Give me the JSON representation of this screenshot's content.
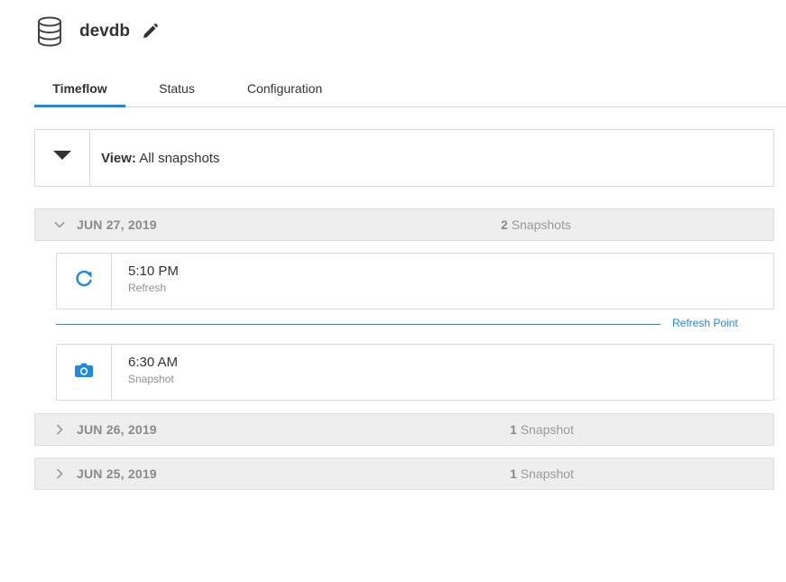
{
  "header": {
    "title": "devdb",
    "icon": "database-icon",
    "edit_icon": "pencil-icon"
  },
  "tabs": [
    {
      "label": "Timeflow",
      "active": true
    },
    {
      "label": "Status",
      "active": false
    },
    {
      "label": "Configuration",
      "active": false
    }
  ],
  "view": {
    "prefix": "View:",
    "value": "All snapshots",
    "toggle_icon": "caret-down-icon"
  },
  "groups": [
    {
      "date": "JUN 27, 2019",
      "count": "2",
      "count_label": "Snapshots",
      "expanded": true,
      "items": [
        {
          "time": "5:10 PM",
          "type": "Refresh",
          "icon": "refresh-icon"
        },
        {
          "time": "6:30 AM",
          "type": "Snapshot",
          "icon": "camera-icon"
        }
      ],
      "marker_label": "Refresh Point"
    },
    {
      "date": "JUN 26, 2019",
      "count": "1",
      "count_label": "Snapshot",
      "expanded": false
    },
    {
      "date": "JUN 25, 2019",
      "count": "1",
      "count_label": "Snapshot",
      "expanded": false
    }
  ],
  "colors": {
    "accent": "#1e88e5",
    "group_bg": "#eeeeee",
    "border": "#d9d9d9"
  }
}
